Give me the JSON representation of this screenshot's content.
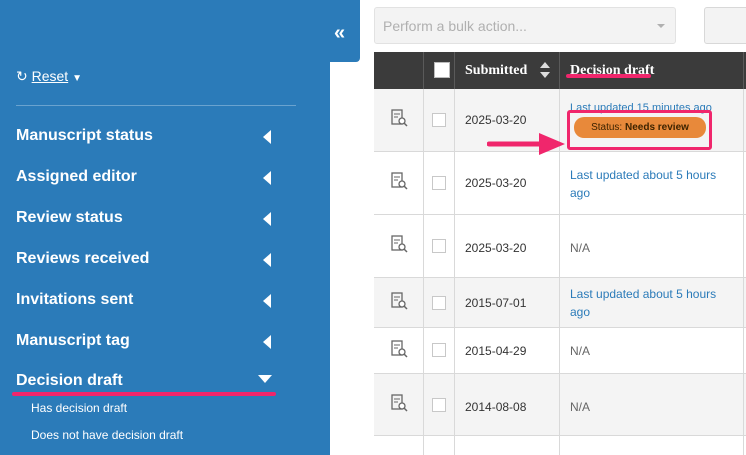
{
  "sidebar": {
    "collapse_icon": "«",
    "reset_label": "Reset",
    "filters": [
      {
        "label": "Manuscript status",
        "expanded": false
      },
      {
        "label": "Assigned editor",
        "expanded": false
      },
      {
        "label": "Review status",
        "expanded": false
      },
      {
        "label": "Reviews received",
        "expanded": false
      },
      {
        "label": "Invitations sent",
        "expanded": false
      },
      {
        "label": "Manuscript tag",
        "expanded": false
      },
      {
        "label": "Decision draft",
        "expanded": true
      }
    ],
    "decision_draft_options": [
      "Has decision draft",
      "Does not have decision draft"
    ],
    "highlight_color": "#f0266c"
  },
  "toolbar": {
    "bulk_action_placeholder": "Perform a bulk action..."
  },
  "table": {
    "columns": [
      "",
      "",
      "Submitted",
      "Decision draft"
    ],
    "rows": [
      {
        "submitted": "2025-03-20",
        "decision_draft": "Last updated 15 minutes ago",
        "is_link": true,
        "status_prefix": "Status:",
        "status_value": "Needs review"
      },
      {
        "submitted": "2025-03-20",
        "decision_draft": "Last updated about 5 hours ago",
        "is_link": true
      },
      {
        "submitted": "2025-03-20",
        "decision_draft": "N/A",
        "is_link": false
      },
      {
        "submitted": "2015-07-01",
        "decision_draft": "Last updated about 5 hours ago",
        "is_link": true
      },
      {
        "submitted": "2015-04-29",
        "decision_draft": "N/A",
        "is_link": false
      },
      {
        "submitted": "2014-08-08",
        "decision_draft": "N/A",
        "is_link": false
      }
    ]
  },
  "colors": {
    "sidebar_bg": "#2b7bb9",
    "table_header_bg": "#3b3b3b",
    "status_badge": "#e8893a",
    "link": "#2b7bb9",
    "annotation": "#f0266c"
  }
}
